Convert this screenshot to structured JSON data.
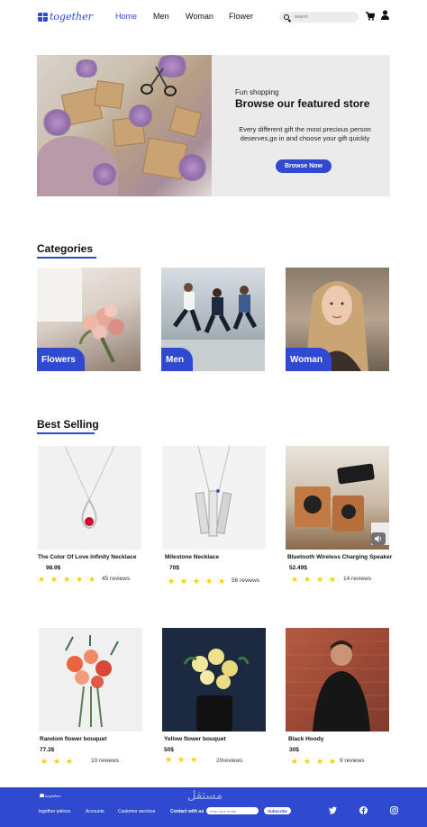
{
  "header": {
    "logo_text": "together",
    "nav": [
      "Home",
      "Men",
      "Woman",
      "Flower"
    ],
    "search_placeholder": "search"
  },
  "hero": {
    "kicker": "Fun shopping",
    "title": "Browse our featured store",
    "description": "Every different gift the most precious person deserves,go in and choose your gift quickly",
    "button": "Browse Now"
  },
  "categories": {
    "title": "Categories",
    "items": [
      "Flowers",
      "Men",
      "Woman"
    ]
  },
  "best_selling": {
    "title": "Best Selling",
    "products": [
      {
        "name": "The Color Of Love Infinity Necklace",
        "price": "98.9$",
        "stars": 5,
        "reviews": "45 reviews"
      },
      {
        "name": "Milestone Necklace",
        "price": "70$",
        "stars": 5,
        "reviews": "56 reviews"
      },
      {
        "name": "Bluetooth Wireless Charging Speaker",
        "price": "52.49$",
        "stars": 4,
        "reviews": "14 reviews"
      },
      {
        "name": "Random flower bouquet",
        "price": "77.3$",
        "stars": 3,
        "reviews": "10 reviews"
      },
      {
        "name": "Yellow flower bouquet",
        "price": "50$",
        "stars": 3,
        "reviews": "20reviews"
      },
      {
        "name": "Black Hoody",
        "price": "30$",
        "stars": 4,
        "reviews": "9 reviews"
      }
    ]
  },
  "footer": {
    "logo_text": "together",
    "links": [
      "together polices",
      "Accounts",
      "Customer services"
    ],
    "contact": "Contact with us",
    "email_placeholder": "enter your email",
    "subscribe": "Subscribe",
    "watermark": "مستقل"
  },
  "colors": {
    "accent": "#2f49d1",
    "star": "#f5d000",
    "hero_bg": "#ebebeb"
  },
  "icons": [
    "search-icon",
    "cart-icon",
    "user-icon",
    "twitter-icon",
    "facebook-icon",
    "instagram-icon",
    "volume-icon"
  ]
}
